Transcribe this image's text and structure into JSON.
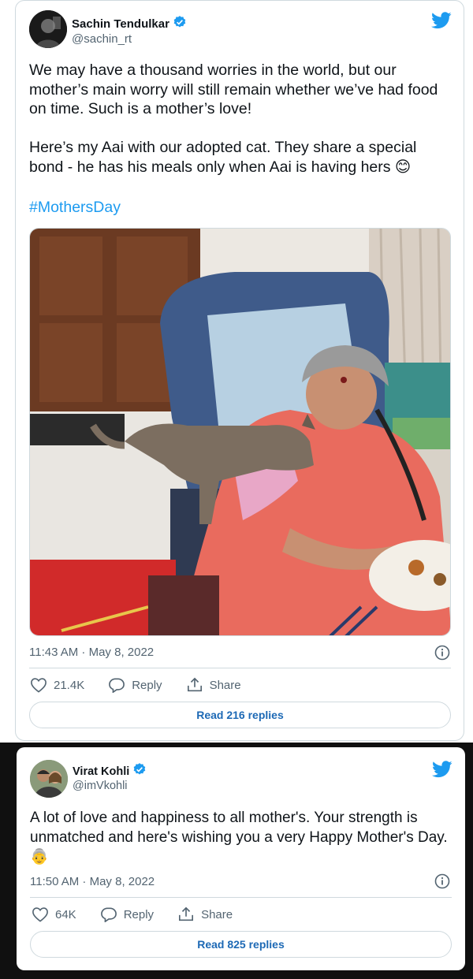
{
  "tweets": [
    {
      "name": "Sachin Tendulkar",
      "handle": "@sachin_rt",
      "text": "We may have a thousand worries in the world, but our mother’s main worry will still remain whether we’ve had food on time. Such is a mother’s love!\n\nHere’s my Aai with our adopted cat. They share a special bond - he has his meals only when Aai is having hers 😊",
      "hashtag": "#MothersDay",
      "time": "11:43 AM · May 8, 2022",
      "likes": "21.4K",
      "reply_label": "Reply",
      "share_label": "Share",
      "read_replies": "Read 216 replies"
    },
    {
      "name": "Virat Kohli",
      "handle": "@imVkohli",
      "text": "A lot of love and happiness to all mother's. Your strength is unmatched and here's wishing you a very Happy Mother's Day. 👵",
      "time": "11:50 AM · May 8, 2022",
      "likes": "64K",
      "reply_label": "Reply",
      "share_label": "Share",
      "read_replies": "Read 825 replies"
    }
  ],
  "colors": {
    "accent": "#1d9bf0",
    "link_button": "#1d69b5",
    "text": "#0f1419",
    "secondary": "#536471",
    "border": "#cfd9de"
  },
  "icons": [
    "twitter-bird-icon",
    "verified-badge-icon",
    "heart-icon",
    "reply-icon",
    "share-icon",
    "info-icon"
  ]
}
